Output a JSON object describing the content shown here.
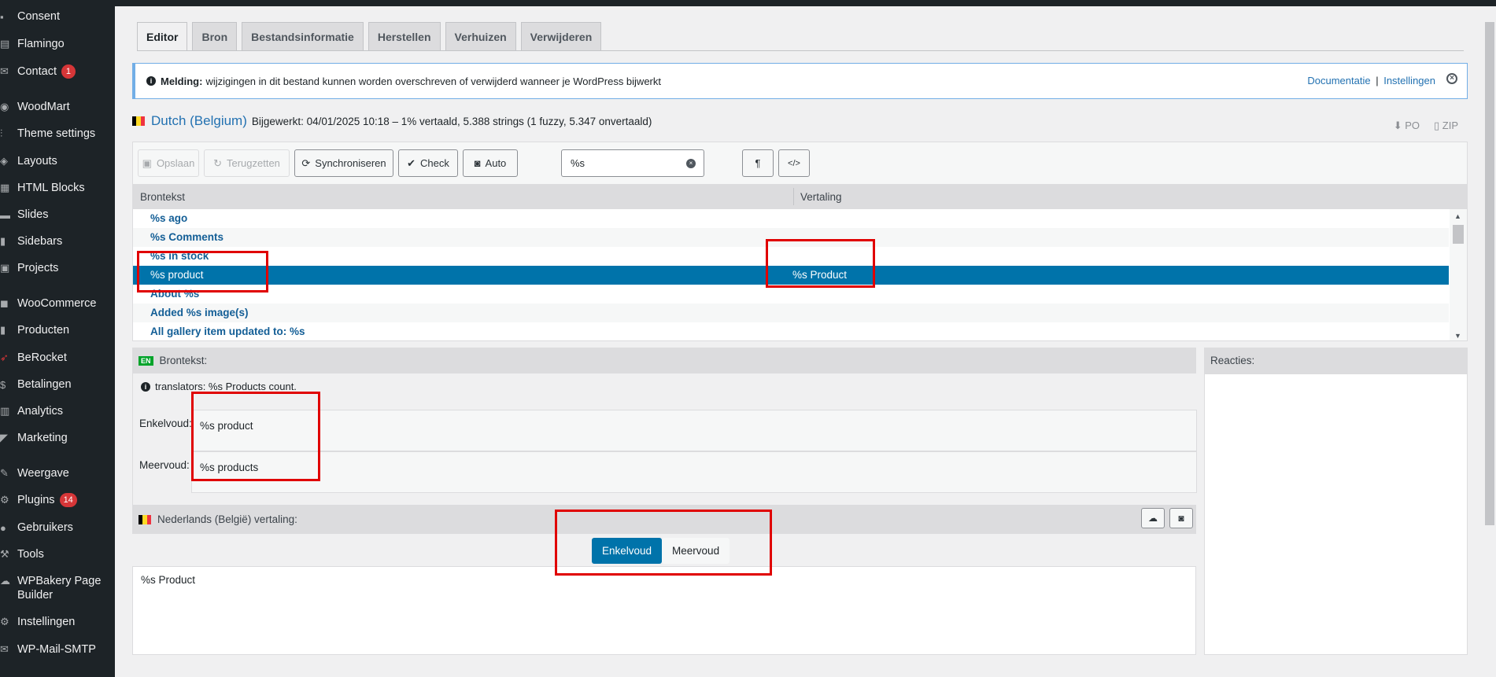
{
  "sidebar": {
    "items": [
      {
        "label": "Consent",
        "icon": "consent-icon"
      },
      {
        "label": "Flamingo",
        "icon": "flamingo-icon"
      },
      {
        "label": "Contact",
        "icon": "mail-icon",
        "badge": "1"
      },
      {
        "label": "WoodMart",
        "icon": "woodmart-icon"
      },
      {
        "label": "Theme settings",
        "icon": "sliders-icon"
      },
      {
        "label": "Layouts",
        "icon": "layers-icon"
      },
      {
        "label": "HTML Blocks",
        "icon": "blocks-icon"
      },
      {
        "label": "Slides",
        "icon": "slides-icon"
      },
      {
        "label": "Sidebars",
        "icon": "sidebar-icon"
      },
      {
        "label": "Projects",
        "icon": "projects-icon"
      },
      {
        "label": "WooCommerce",
        "icon": "woo-icon"
      },
      {
        "label": "Producten",
        "icon": "products-icon"
      },
      {
        "label": "BeRocket",
        "icon": "rocket-icon"
      },
      {
        "label": "Betalingen",
        "icon": "payments-icon"
      },
      {
        "label": "Analytics",
        "icon": "analytics-icon"
      },
      {
        "label": "Marketing",
        "icon": "megaphone-icon"
      },
      {
        "label": "Weergave",
        "icon": "brush-icon"
      },
      {
        "label": "Plugins",
        "icon": "plugin-icon",
        "badge": "14"
      },
      {
        "label": "Gebruikers",
        "icon": "users-icon"
      },
      {
        "label": "Tools",
        "icon": "wrench-icon"
      },
      {
        "label": "WPBakery Page Builder",
        "icon": "cloud-icon"
      },
      {
        "label": "Instellingen",
        "icon": "settings-icon"
      },
      {
        "label": "WP-Mail-SMTP",
        "icon": "mail-smtp-icon"
      }
    ]
  },
  "tabs": [
    "Editor",
    "Bron",
    "Bestandsinformatie",
    "Herstellen",
    "Verhuizen",
    "Verwijderen"
  ],
  "notice": {
    "label": "Melding:",
    "text": "wijzigingen in dit bestand kunnen worden overschreven of verwijderd wanneer je WordPress bijwerkt",
    "link1": "Documentatie",
    "separator": "|",
    "link2": "Instellingen"
  },
  "header": {
    "language": "Dutch (Belgium)",
    "meta": "Bijgewerkt: 04/01/2025 10:18 – 1% vertaald, 5.388 strings (1 fuzzy, 5.347 onvertaald)",
    "download_po": "PO",
    "download_zip": "ZIP"
  },
  "toolbar": {
    "save": "Opslaan",
    "revert": "Terugzetten",
    "sync": "Synchroniseren",
    "check": "Check",
    "auto": "Auto",
    "search_value": "%s",
    "pilcrow": "¶",
    "code": "</>"
  },
  "list": {
    "col_source": "Brontekst",
    "col_translation": "Vertaling",
    "rows": [
      {
        "source": "%s ago",
        "translation": ""
      },
      {
        "source": "%s Comments",
        "translation": ""
      },
      {
        "source": "%s in stock",
        "translation": ""
      },
      {
        "source": "%s product",
        "translation": "%s Product"
      },
      {
        "source": "About %s",
        "translation": ""
      },
      {
        "source": "Added %s image(s)",
        "translation": ""
      },
      {
        "source": "All gallery item updated to: %s",
        "translation": ""
      }
    ]
  },
  "source_panel": {
    "lang_badge": "EN",
    "title": "Brontekst:",
    "translators_note": "translators: %s Products count.",
    "singular_label": "Enkelvoud:",
    "singular_value": "%s product",
    "plural_label": "Meervoud:",
    "plural_value": "%s products"
  },
  "translation_panel": {
    "title": "Nederlands (België) vertaling:",
    "tab_singular": "Enkelvoud",
    "tab_plural": "Meervoud",
    "value": "%s Product"
  },
  "comments_panel": {
    "title": "Reacties:"
  },
  "colors": {
    "accent": "#0073aa",
    "highlight": "#e00000",
    "sidebar_bg": "#1d2327",
    "badge": "#d63638"
  }
}
